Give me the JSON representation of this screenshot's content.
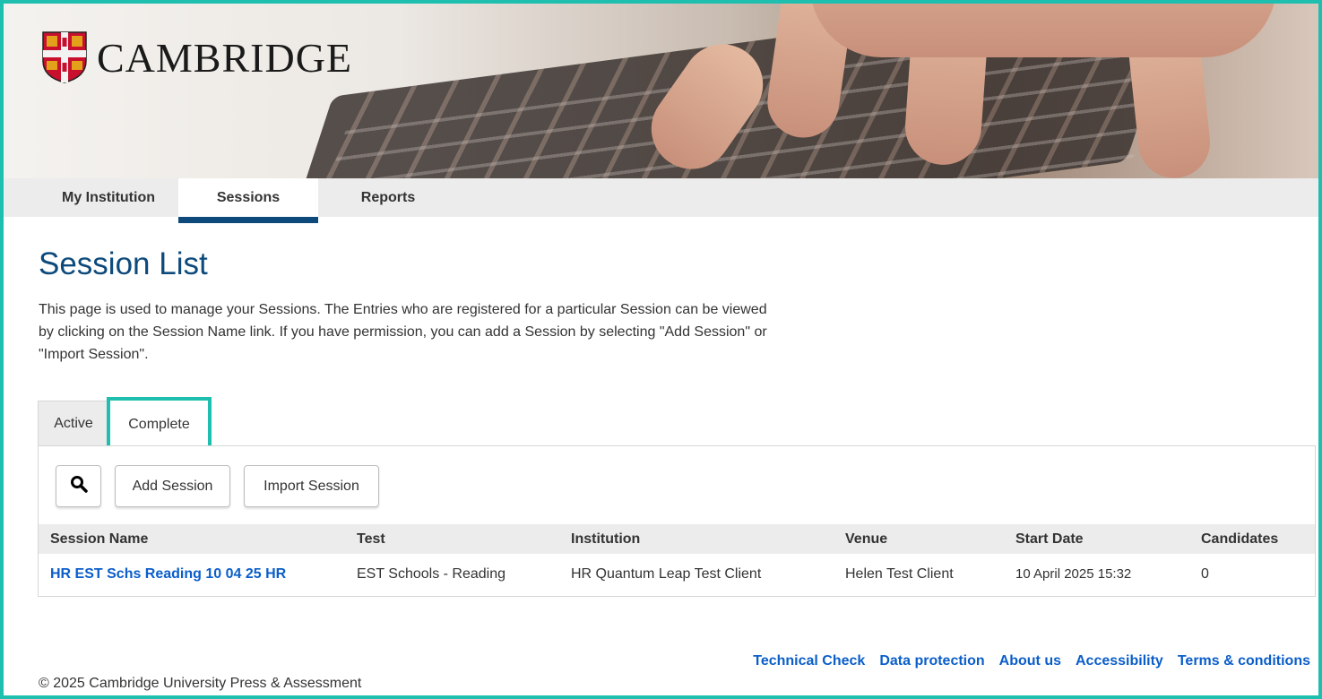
{
  "brand": {
    "name": "CAMBRIDGE"
  },
  "nav": {
    "items": [
      {
        "label": "My Institution"
      },
      {
        "label": "Sessions"
      },
      {
        "label": "Reports"
      }
    ]
  },
  "page": {
    "title": "Session List",
    "description": "This page is used to manage your Sessions. The Entries who are registered for a particular Session can be viewed by clicking on the Session Name link. If you have permission, you can add a Session by selecting \"Add Session\" or \"Import Session\"."
  },
  "tabs": [
    {
      "label": "Active"
    },
    {
      "label": "Complete"
    }
  ],
  "toolbar": {
    "search_icon": "search-icon",
    "add_label": "Add Session",
    "import_label": "Import Session"
  },
  "table": {
    "columns": [
      "Session Name",
      "Test",
      "Institution",
      "Venue",
      "Start Date",
      "Candidates"
    ],
    "rows": [
      [
        "HR EST Schs Reading 10 04 25 HR",
        "EST Schools - Reading",
        "HR Quantum Leap Test Client",
        "Helen Test Client",
        "10 April 2025 15:32",
        "0"
      ]
    ]
  },
  "footer": {
    "links": [
      "Technical Check",
      "Data protection",
      "About us",
      "Accessibility",
      "Terms & conditions"
    ],
    "copyright": "© 2025 Cambridge University Press & Assessment"
  },
  "colors": {
    "accent": "#0d4a7b",
    "link": "#0b5ec9",
    "highlight": "#1fbfb0"
  }
}
